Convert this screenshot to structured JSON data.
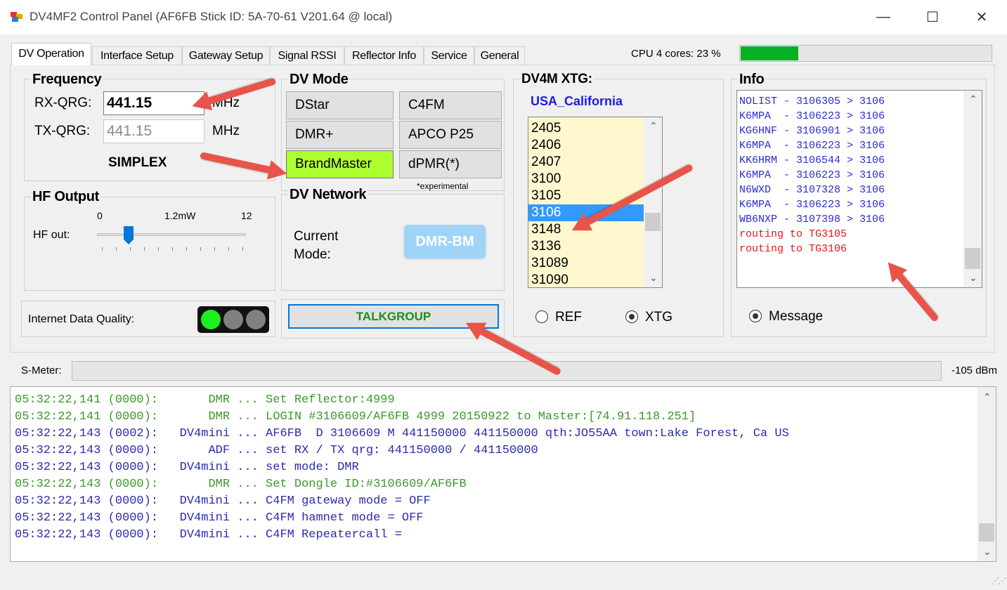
{
  "window": {
    "title": "DV4MF2 Control Panel (AF6FB Stick ID: 5A-70-61 V201.64 @ local)",
    "min_glyph": "—",
    "max_glyph": "☐",
    "close_glyph": "✕"
  },
  "tabs": [
    "DV Operation",
    "Interface Setup",
    "Gateway Setup",
    "Signal RSSI",
    "Reflector Info",
    "Service",
    "General"
  ],
  "cpu": {
    "label": "CPU 4 cores: 23 %",
    "percent": 23
  },
  "frequency": {
    "title": "Frequency",
    "rx_label": "RX-QRG:",
    "rx_value": "441.15",
    "rx_unit": "MHz",
    "tx_label": "TX-QRG:",
    "tx_value": "441.15",
    "tx_unit": "MHz",
    "mode_text": "SIMPLEX"
  },
  "hf_output": {
    "title": "HF Output",
    "label": "HF out:",
    "scale_min": "0",
    "scale_mid": "1.2mW",
    "scale_max": "12",
    "level": 0.2
  },
  "internet_quality": {
    "label": "Internet Data Quality:"
  },
  "dv_mode": {
    "title": "DV Mode",
    "buttons": [
      "DStar",
      "C4FM",
      "DMR+",
      "APCO P25",
      "BrandMaster",
      "dPMR(*)"
    ],
    "note": "*experimental",
    "selected": "BrandMaster"
  },
  "dv_network": {
    "title": "DV Network",
    "current_label_1": "Current",
    "current_label_2": "Mode:",
    "mode_badge": "DMR-BM"
  },
  "talkgroup_button": "TALKGROUP",
  "xtg": {
    "title": "DV4M XTG:",
    "region": "USA_California",
    "items": [
      "2405",
      "2406",
      "2407",
      "3100",
      "3105",
      "3106",
      "3148",
      "3136",
      "31089",
      "31090"
    ],
    "selected": "3106",
    "radio_ref": "REF",
    "radio_xtg": "XTG"
  },
  "info": {
    "title": "Info",
    "lines": [
      "NOLIST - 3106305 > 3106",
      "K6MPA  - 3106223 > 3106",
      "KG6HNF - 3106901 > 3106",
      "K6MPA  - 3106223 > 3106",
      "KK6HRM - 3106544 > 3106",
      "K6MPA  - 3106223 > 3106",
      "N6WXD  - 3107328 > 3106",
      "K6MPA  - 3106223 > 3106",
      "WB6NXP - 3107398 > 3106",
      "routing to TG3105",
      "routing to TG3106"
    ],
    "radio_message": "Message"
  },
  "smeter": {
    "label": "S-Meter:",
    "value": "-105 dBm"
  },
  "log": [
    {
      "t": "05:32:22,141 (0000):       DMR ... Set Reflector:4999",
      "c": "green"
    },
    {
      "t": "05:32:22,141 (0000):       DMR ... LOGIN #3106609/AF6FB 4999 20150922 to Master:[74.91.118.251]",
      "c": "green"
    },
    {
      "t": "05:32:22,143 (0002):   DV4mini ... AF6FB  D 3106609 M 441150000 441150000 qth:JO55AA town:Lake Forest, Ca US",
      "c": "blue"
    },
    {
      "t": "05:32:22,143 (0000):       ADF ... set RX / TX qrg: 441150000 / 441150000",
      "c": "blue"
    },
    {
      "t": "05:32:22,143 (0000):   DV4mini ... set mode: DMR",
      "c": "blue"
    },
    {
      "t": "05:32:22,143 (0000):       DMR ... Set Dongle ID:#3106609/AF6FB",
      "c": "green"
    },
    {
      "t": "05:32:22,143 (0000):   DV4mini ... C4FM gateway mode = OFF",
      "c": "blue"
    },
    {
      "t": "05:32:22,143 (0000):   DV4mini ... C4FM hamnet mode = OFF",
      "c": "blue"
    },
    {
      "t": "05:32:22,143 (0000):   DV4mini ... C4FM Repeatercall =",
      "c": "blue"
    }
  ],
  "colors": {
    "green_log": "#3a9a2a",
    "blue_log": "#2b2bb0",
    "info_blue": "#2a2ad8",
    "info_red": "#e01818",
    "region_blue": "#1a1aee",
    "talkgroup_green": "#1e8c1e",
    "annotation_red": "#e8544a"
  },
  "icons": {
    "app": "app-icon",
    "scroll_up": "▲",
    "scroll_down": "▼"
  }
}
